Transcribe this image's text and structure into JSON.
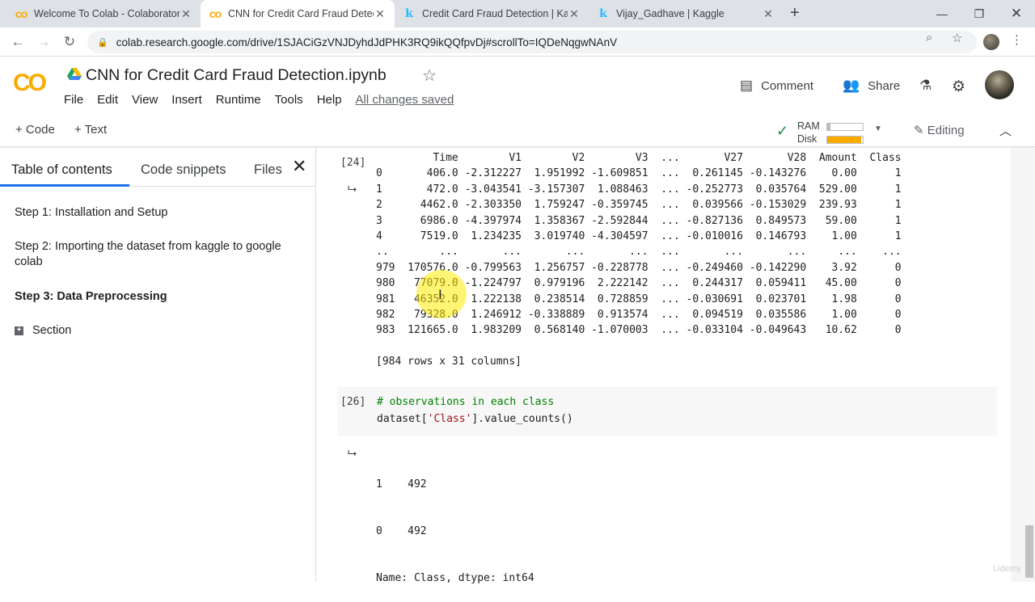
{
  "browser": {
    "tabs": [
      {
        "title": "Welcome To Colab - Colaboratory",
        "icon": "colab-icon",
        "active": false
      },
      {
        "title": "CNN for Credit Card Fraud Detection",
        "icon": "colab-icon",
        "active": true
      },
      {
        "title": "Credit Card Fraud Detection | Kaggle",
        "icon": "kaggle-icon",
        "active": false
      },
      {
        "title": "Vijay_Gadhave | Kaggle",
        "icon": "kaggle-icon",
        "active": false
      }
    ],
    "new_tab": "+",
    "url": "colab.research.google.com/drive/1SJACiGzVNJDyhdJdPHK3RQ9ikQQfpvDj#scrollTo=IQDeNqgwNAnV"
  },
  "colab": {
    "logo": "CO",
    "notebook_title": "CNN for Credit Card Fraud Detection.ipynb",
    "menu": [
      "File",
      "Edit",
      "View",
      "Insert",
      "Runtime",
      "Tools",
      "Help"
    ],
    "saved_status": "All changes saved",
    "comment_label": "Comment",
    "share_label": "Share",
    "toolbar": {
      "add_code": "+ Code",
      "add_text": "+ Text",
      "ram_label": "RAM",
      "disk_label": "Disk",
      "ram_usage": 0.1,
      "disk_usage": 0.95,
      "ram_color": "#bdbdbd",
      "disk_color": "#f9ab00",
      "editing_label": "Editing"
    }
  },
  "sidebar": {
    "tabs": [
      "Table of contents",
      "Code snippets",
      "Files"
    ],
    "toc": [
      {
        "text": "Step 1: Installation and Setup",
        "bold": false
      },
      {
        "text": "Step 2: Importing the dataset from kaggle to google colab",
        "bold": false
      },
      {
        "text": "Step 3: Data Preprocessing",
        "bold": true
      }
    ],
    "section_label": "Section"
  },
  "cells": {
    "cell24": {
      "exec_count": "[24]",
      "dataframe_rows": [
        "         Time        V1        V2        V3  ...       V27       V28  Amount  Class",
        "0       406.0 -2.312227  1.951992 -1.609851  ...  0.261145 -0.143276    0.00      1",
        "1       472.0 -3.043541 -3.157307  1.088463  ... -0.252773  0.035764  529.00      1",
        "2      4462.0 -2.303350  1.759247 -0.359745  ...  0.039566 -0.153029  239.93      1",
        "3      6986.0 -4.397974  1.358367 -2.592844  ... -0.827136  0.849573   59.00      1",
        "4      7519.0  1.234235  3.019740 -4.304597  ... -0.010016  0.146793    1.00      1",
        "..        ...       ...       ...       ...  ...       ...       ...     ...    ...",
        "979  170576.0 -0.799563  1.256757 -0.228778  ... -0.249460 -0.142290    3.92      0",
        "980   77079.0 -1.224797  0.979196  2.222142  ...  0.244317  0.059411   45.00      0",
        "981   46352.0  1.222138  0.238514  0.728859  ... -0.030691  0.023701    1.98      0",
        "982   79328.0  1.246912 -0.338889  0.913574  ...  0.094519  0.035586    1.00      0",
        "983  121665.0  1.983209  0.568140 -1.070003  ... -0.033104 -0.049643   10.62      0"
      ],
      "summary": "[984 rows x 31 columns]"
    },
    "cell26": {
      "exec_count": "[26]",
      "code_comment": "# observations in each class",
      "code_prefix": "dataset[",
      "code_string": "'Class'",
      "code_suffix": "].value_counts()",
      "output_lines": [
        "1    492",
        "0    492",
        "Name: Class, dtype: int64"
      ]
    }
  },
  "watermark": "Udemy"
}
